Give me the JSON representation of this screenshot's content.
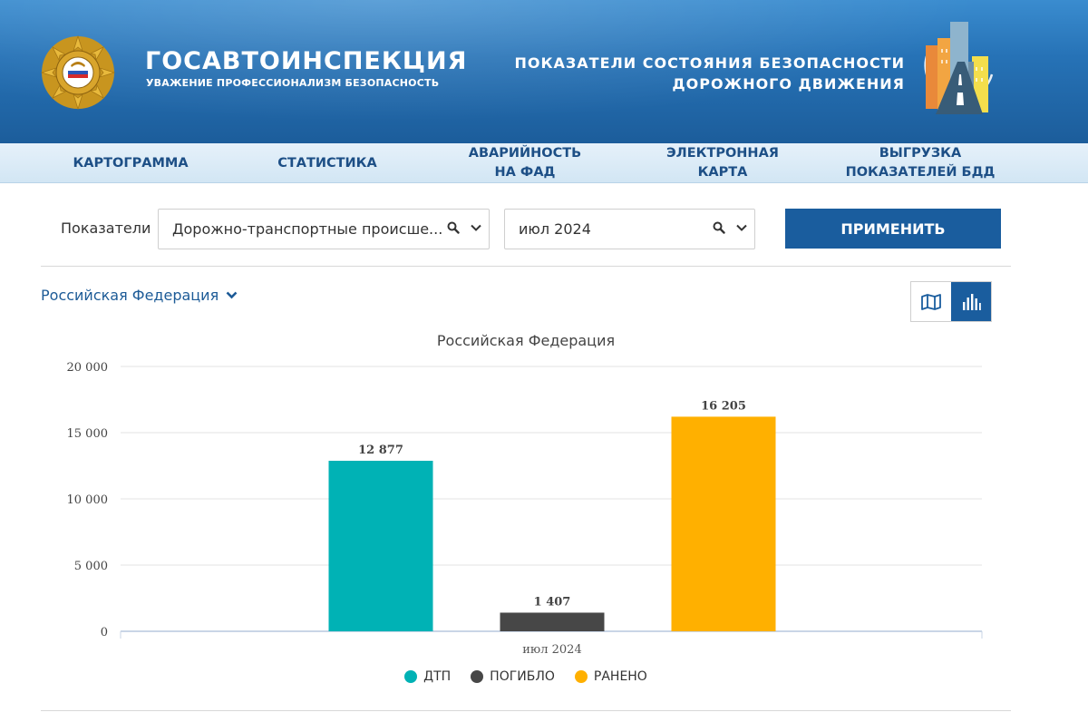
{
  "header": {
    "brand_title": "ГОСАВТОИНСПЕКЦИЯ",
    "brand_subtitle": "УВАЖЕНИЕ ПРОФЕССИОНАЛИЗМ БЕЗОПАСНОСТЬ",
    "right_title_line1": "ПОКАЗАТЕЛИ СОСТОЯНИЯ БЕЗОПАСНОСТИ",
    "right_title_line2": "ДОРОЖНОГО ДВИЖЕНИЯ"
  },
  "nav": {
    "items": [
      {
        "line1": "КАРТОГРАММА",
        "line2": ""
      },
      {
        "line1": "СТАТИСТИКА",
        "line2": ""
      },
      {
        "line1": "АВАРИЙНОСТЬ",
        "line2": "НА ФАД"
      },
      {
        "line1": "ЭЛЕКТРОННАЯ",
        "line2": "КАРТА"
      },
      {
        "line1": "ВЫГРУЗКА",
        "line2": "ПОКАЗАТЕЛЕЙ БДД"
      }
    ]
  },
  "filters": {
    "label": "Показатели",
    "indicator_value": "Дорожно-транспортные происше...",
    "period_value": "июл 2024",
    "apply_label": "ПРИМЕНИТЬ"
  },
  "region": {
    "label": "Российская Федерация"
  },
  "colors": {
    "accent": "#1a5d9e",
    "dtp": "#00b2b5",
    "killed": "#474747",
    "injured": "#ffb000"
  },
  "chart_data": {
    "type": "bar",
    "title": "Российская Федерация",
    "categories": [
      "июл 2024"
    ],
    "series": [
      {
        "name": "ДТП",
        "values": [
          12877
        ],
        "label": "12 877",
        "color": "#00b2b5"
      },
      {
        "name": "ПОГИБЛО",
        "values": [
          1407
        ],
        "label": "1 407",
        "color": "#474747"
      },
      {
        "name": "РАНЕНО",
        "values": [
          16205
        ],
        "label": "16 205",
        "color": "#ffb000"
      }
    ],
    "yticks": [
      0,
      5000,
      10000,
      15000,
      20000
    ],
    "ytick_labels": [
      "0",
      "5 000",
      "10 000",
      "15 000",
      "20 000"
    ],
    "ylim": [
      0,
      20000
    ],
    "grid": true,
    "legend_position": "bottom"
  }
}
